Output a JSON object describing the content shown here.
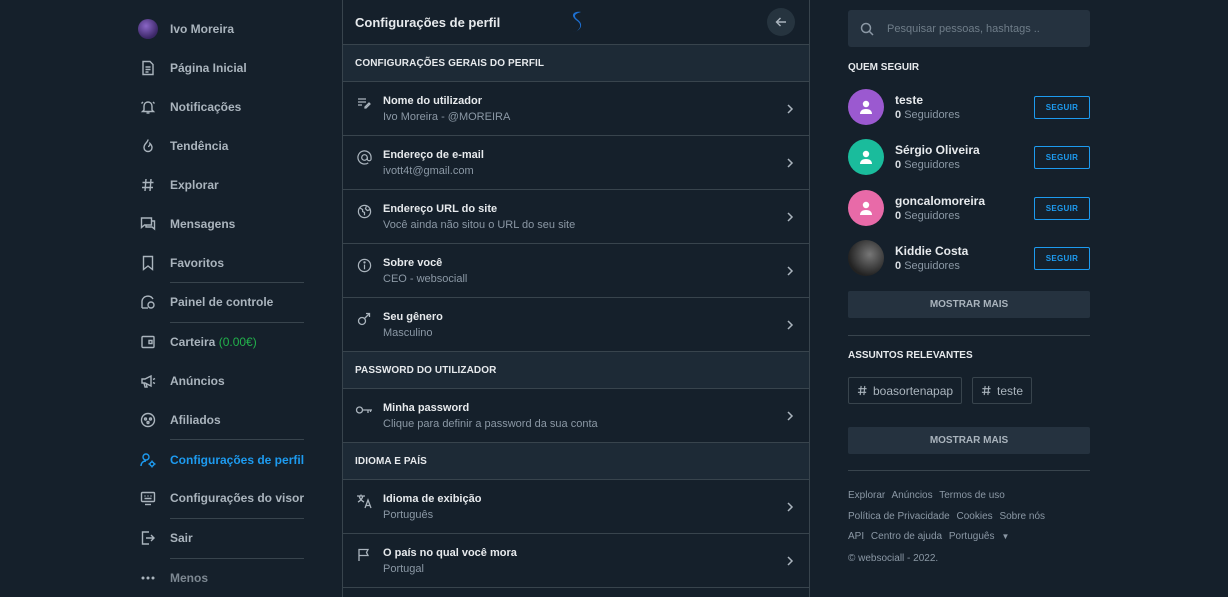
{
  "nav": {
    "user_name": "Ivo Moreira",
    "home": "Página Inicial",
    "notifications": "Notificações",
    "trending": "Tendência",
    "explore": "Explorar",
    "messages": "Mensagens",
    "favorites": "Favoritos",
    "dashboard": "Painel de controle",
    "wallet": "Carteira",
    "wallet_balance": "(0.00€)",
    "ads": "Anúncios",
    "affiliates": "Afiliados",
    "profile_settings": "Configurações de perfil",
    "display_settings": "Configurações do visor",
    "logout": "Sair",
    "more": "Menos"
  },
  "center": {
    "title": "Configurações de perfil",
    "sections": [
      {
        "header": "CONFIGURAÇÕES GERAIS DO PERFIL",
        "rows": [
          {
            "title": "Nome do utilizador",
            "value": "Ivo Moreira - @MOREIRA"
          },
          {
            "title": "Endereço de e-mail",
            "value": "ivott4t@gmail.com"
          },
          {
            "title": "Endereço URL do site",
            "value": "Você ainda não sitou o URL do seu site"
          },
          {
            "title": "Sobre você",
            "value": "CEO - websociall"
          },
          {
            "title": "Seu gênero",
            "value": "Masculino"
          }
        ]
      },
      {
        "header": "PASSWORD DO UTILIZADOR",
        "rows": [
          {
            "title": "Minha password",
            "value": "Clique para definir a password da sua conta"
          }
        ]
      },
      {
        "header": "IDIOMA E PAÍS",
        "rows": [
          {
            "title": "Idioma de exibição",
            "value": "Português"
          },
          {
            "title": "O país no qual você mora",
            "value": "Portugal"
          }
        ]
      }
    ]
  },
  "right": {
    "search_placeholder": "Pesquisar pessoas, hashtags ..",
    "who_to_follow": "QUEM SEGUIR",
    "follow_button": "SEGUIR",
    "followers_suffix": "Seguidores",
    "suggestions": [
      {
        "name": "teste",
        "followers": "0",
        "color": "#9b59d0"
      },
      {
        "name": "Sérgio Oliveira",
        "followers": "0",
        "color": "#1abc9c"
      },
      {
        "name": "goncalomoreira",
        "followers": "0",
        "color": "#e86aa8"
      },
      {
        "name": "Kiddie Costa",
        "followers": "0",
        "color": "#2b2b2b"
      }
    ],
    "show_more": "MOSTRAR MAIS",
    "relevant_topics": "ASSUNTOS RELEVANTES",
    "topics": [
      "boasortenapap",
      "teste"
    ],
    "show_more_topics": "MOSTRAR MAIS",
    "footer": {
      "links_row1": [
        "Explorar",
        "Anúncios",
        "Termos de uso"
      ],
      "links_row2": [
        "Política de Privacidade",
        "Cookies",
        "Sobre nós"
      ],
      "links_row3": [
        "API",
        "Centro de ajuda"
      ],
      "language": "Português",
      "copyright": "© websociall - 2022."
    }
  },
  "colors": {
    "background": "#15202b",
    "accent": "#1d9bf0",
    "balance_green": "#22b14c"
  }
}
